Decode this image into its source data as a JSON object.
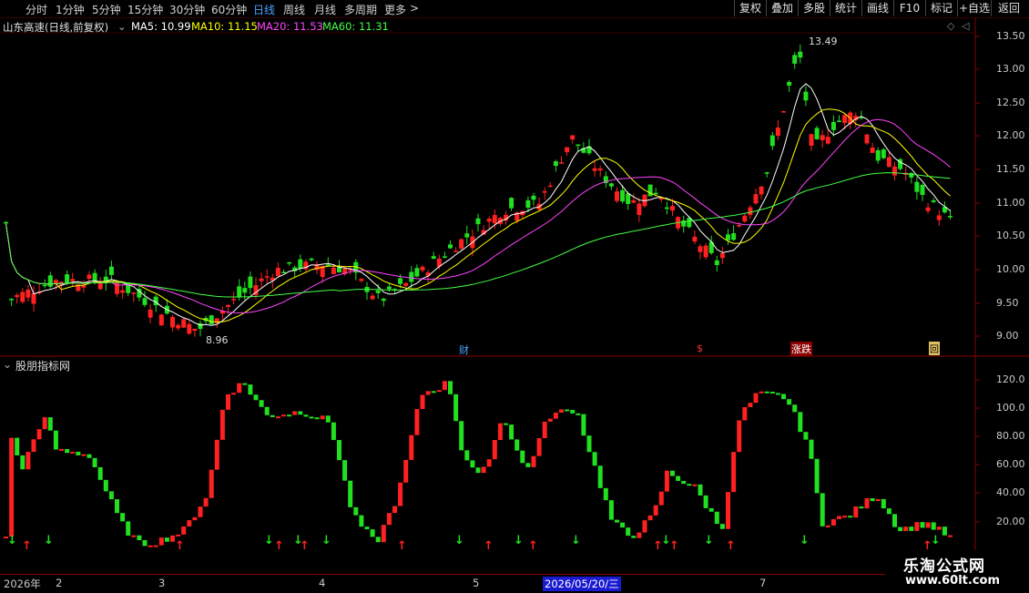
{
  "toolbar": {
    "tabs": [
      "分时",
      "1分钟",
      "5分钟",
      "15分钟",
      "30分钟",
      "60分钟",
      "日线",
      "周线",
      "月线",
      "多周期",
      "更多"
    ],
    "active_tab": "日线",
    "more_arrow": ">",
    "right_buttons": [
      "复权",
      "叠加",
      "多股",
      "统计",
      "画线",
      "F10",
      "标记",
      "+自选",
      "返回"
    ]
  },
  "info": {
    "title": "山东高速(日线,前复权)",
    "ma5": "MA5: 10.99",
    "ma10": "MA10: 11.15",
    "ma20": "MA20: 11.53",
    "ma60": "MA60: 11.31",
    "colors": {
      "ma5": "#ffffff",
      "ma10": "#ffff00",
      "ma20": "#ff44ff",
      "ma60": "#44ff44"
    }
  },
  "price_axis": [
    "13.50",
    "13.00",
    "12.50",
    "12.00",
    "11.50",
    "11.00",
    "10.50",
    "10.00",
    "9.50",
    "9.00"
  ],
  "price_annotations": {
    "high": "13.49",
    "low": "8.96"
  },
  "event_markers": [
    "财",
    "$",
    "涨跌",
    "回"
  ],
  "indicator": {
    "title": "股朋指标网",
    "axis": [
      "120.0",
      "100.0",
      "80.00",
      "60.00",
      "40.00",
      "20.00"
    ]
  },
  "date_axis": [
    "2026年",
    "2",
    "3",
    "4",
    "5",
    "2026/05/20/三",
    "7"
  ],
  "watermark": {
    "line1": "乐淘公式网",
    "line2": "www.60lt.com"
  },
  "colors": {
    "up": "#ff2020",
    "down": "#20e020",
    "axis": "#8a0000"
  }
}
